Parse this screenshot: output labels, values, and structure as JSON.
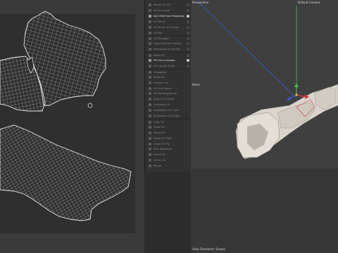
{
  "menu": {
    "items": [
      {
        "label": "Rotate UV 90°",
        "bright": false,
        "sep": false
      },
      {
        "label": "Fit to Canvas",
        "bright": false,
        "sep": false
      },
      {
        "label": "Set UVW from Projection",
        "bright": true,
        "sep": false
      },
      {
        "label": "UV Tiling",
        "bright": false,
        "sep": false
      },
      {
        "label": "UV Mirror and Swap",
        "bright": false,
        "sep": false
      },
      {
        "label": "UV Flip",
        "bright": false,
        "sep": false
      },
      {
        "label": "UV Manager",
        "bright": false,
        "sep": true
      },
      {
        "label": "Align Selected Islands",
        "bright": false,
        "sep": false
      },
      {
        "label": "Normalize UV Islands",
        "bright": false,
        "sep": false
      },
      {
        "label": "Relax UV",
        "bright": false,
        "sep": true
      },
      {
        "label": "Fill UV to Canvas",
        "bright": true,
        "sep": false
      },
      {
        "label": "UV Canvas Scale",
        "bright": false,
        "sep": false
      },
      {
        "label": "Straighten",
        "bright": false,
        "sep": true
      },
      {
        "label": "Stack UV",
        "bright": false,
        "sep": false
      },
      {
        "label": "Unstack UV",
        "bright": false,
        "sep": false
      },
      {
        "label": "UV Grid Island",
        "bright": false,
        "sep": false
      },
      {
        "label": "UV Rectangularize",
        "bright": false,
        "sep": false
      },
      {
        "label": "Align to Checker",
        "bright": false,
        "sep": false
      },
      {
        "label": "Constrain UV",
        "bright": false,
        "sep": false
      },
      {
        "label": "Straighten UV Circle",
        "bright": false,
        "sep": false
      },
      {
        "label": "Straighten UV Shape",
        "bright": false,
        "sep": false
      },
      {
        "label": "Copy UV",
        "bright": false,
        "sep": true
      },
      {
        "label": "Paste UV",
        "bright": false,
        "sep": false
      },
      {
        "label": "Reset UV",
        "bright": false,
        "sep": false
      },
      {
        "label": "Quick UV CSM",
        "bright": false,
        "sep": false
      },
      {
        "label": "Quick UV Ply",
        "bright": false,
        "sep": false
      },
      {
        "label": "Sew Sequence",
        "bright": false,
        "sep": false
      },
      {
        "label": "Island UV",
        "bright": false,
        "sep": false
      },
      {
        "label": "Shrink UV",
        "bright": false,
        "sep": false
      },
      {
        "label": "Merge",
        "bright": false,
        "sep": false
      }
    ]
  },
  "viewport": {
    "view_name": "Perspective",
    "camera_name": "Default Camera",
    "tool_label": "Move",
    "status_text": "View Transform: Screen"
  },
  "colors": {
    "uv_wire": "#e6e6e6",
    "mesh": "#d9d4cc",
    "axis_x": "#d23a3a",
    "axis_y": "#3fbf4f",
    "axis_z": "#3b5bd6"
  }
}
